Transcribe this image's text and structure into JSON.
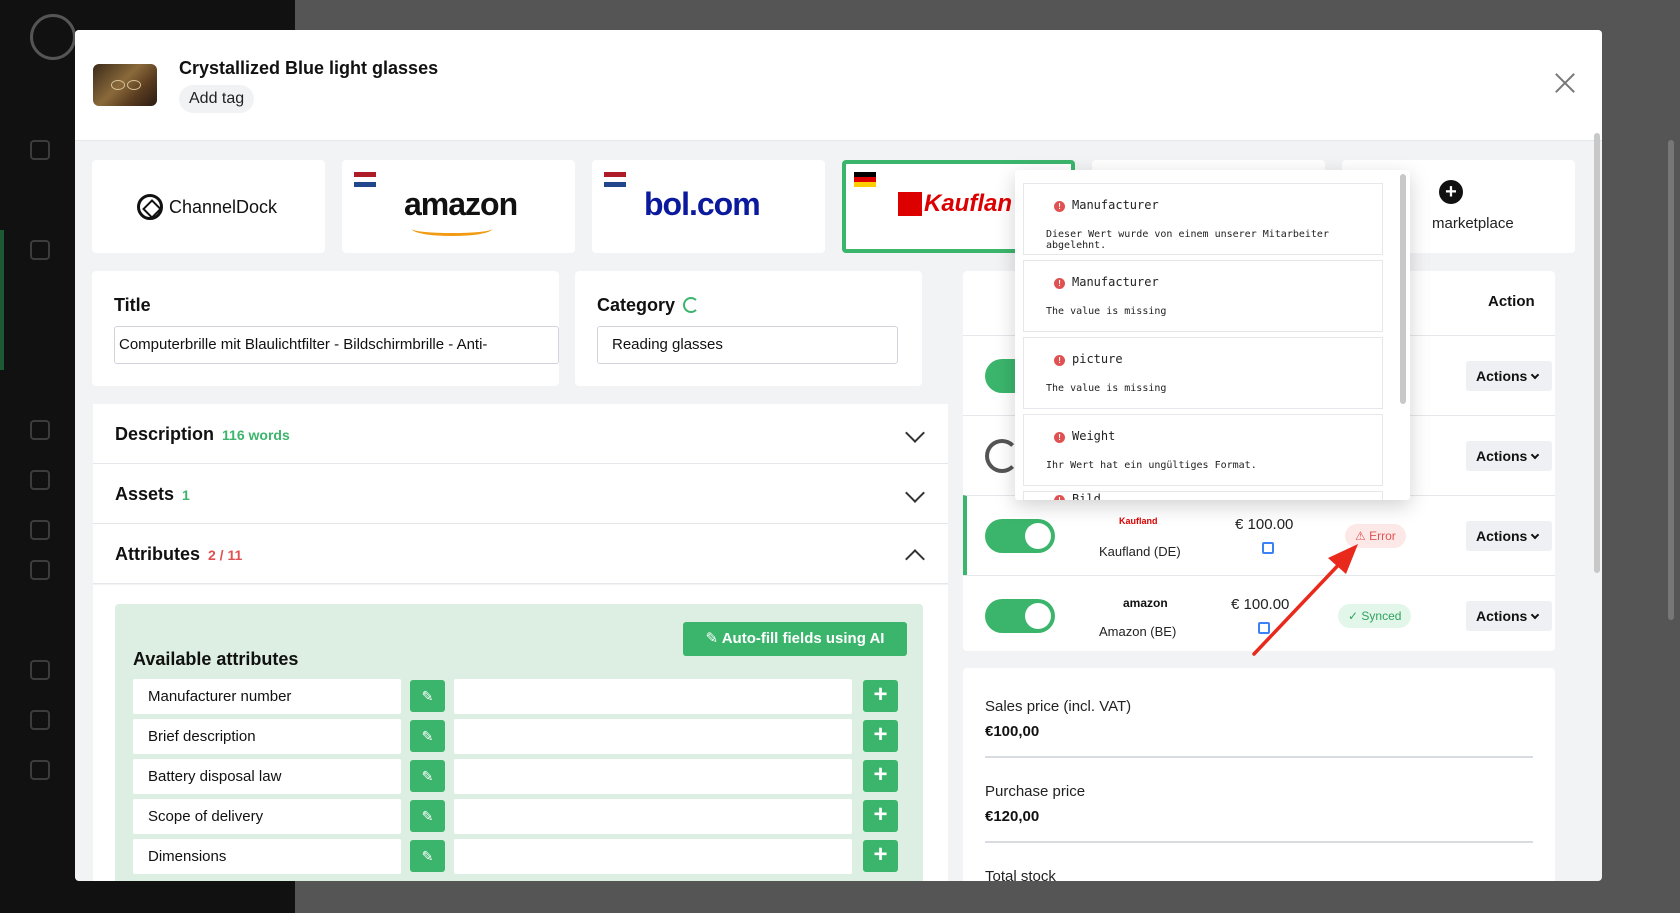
{
  "product": {
    "title": "Crystallized Blue light glasses",
    "add_tag_label": "Add tag"
  },
  "marketplaces": [
    {
      "name": "ChannelDock",
      "logo_text": "ChannelDock",
      "flag": ""
    },
    {
      "name": "amazon",
      "logo_text": "amazon",
      "flag": "NL"
    },
    {
      "name": "bol.com",
      "logo_text": "bol.com",
      "flag": "NL"
    },
    {
      "name": "Kaufland",
      "logo_text": "Kauflan",
      "flag": "DE",
      "selected": true
    }
  ],
  "add_marketplace_label": "marketplace",
  "title_panel": {
    "label": "Title",
    "value": "Computerbrille mit Blaulichtfilter - Bildschirmbrille - Anti-"
  },
  "category_panel": {
    "label": "Category",
    "value": "Reading glasses"
  },
  "sections": {
    "description": {
      "label": "Description",
      "count": "116 words"
    },
    "assets": {
      "label": "Assets",
      "count": "1"
    },
    "attributes": {
      "label": "Attributes",
      "count": "2 / 11"
    }
  },
  "attributes_panel": {
    "ai_button_label": "Auto-fill fields using AI",
    "available_title": "Available attributes",
    "rows": [
      {
        "name": "Manufacturer number"
      },
      {
        "name": "Brief description"
      },
      {
        "name": "Battery disposal law"
      },
      {
        "name": "Scope of delivery"
      },
      {
        "name": "Dimensions"
      }
    ]
  },
  "listing_table": {
    "action_header": "Action",
    "actions_label": "Actions",
    "rows": [
      {
        "marketplace": "Kaufland (DE)",
        "logo": "Kaufland",
        "price": "€ 100.00",
        "status": "Error"
      },
      {
        "marketplace": "Amazon (BE)",
        "logo": "amazon",
        "price": "€ 100.00",
        "status": "Synced"
      }
    ]
  },
  "pricing": {
    "sales_price_label": "Sales price (incl. VAT)",
    "sales_price_value": "€100,00",
    "purchase_price_label": "Purchase price",
    "purchase_price_value": "€120,00",
    "total_stock_label": "Total stock"
  },
  "errors": [
    {
      "field": "Manufacturer",
      "message": "Dieser Wert wurde von einem unserer Mitarbeiter abgelehnt."
    },
    {
      "field": "Manufacturer",
      "message": "The value is missing"
    },
    {
      "field": "picture",
      "message": "The value is missing"
    },
    {
      "field": "Weight",
      "message": "Ihr Wert hat ein ungültiges Format."
    },
    {
      "field": "Bild",
      "message": ""
    }
  ],
  "colors": {
    "accent_green": "#3bb56c",
    "error_red": "#e05252",
    "arrow_red": "#e8291c"
  }
}
